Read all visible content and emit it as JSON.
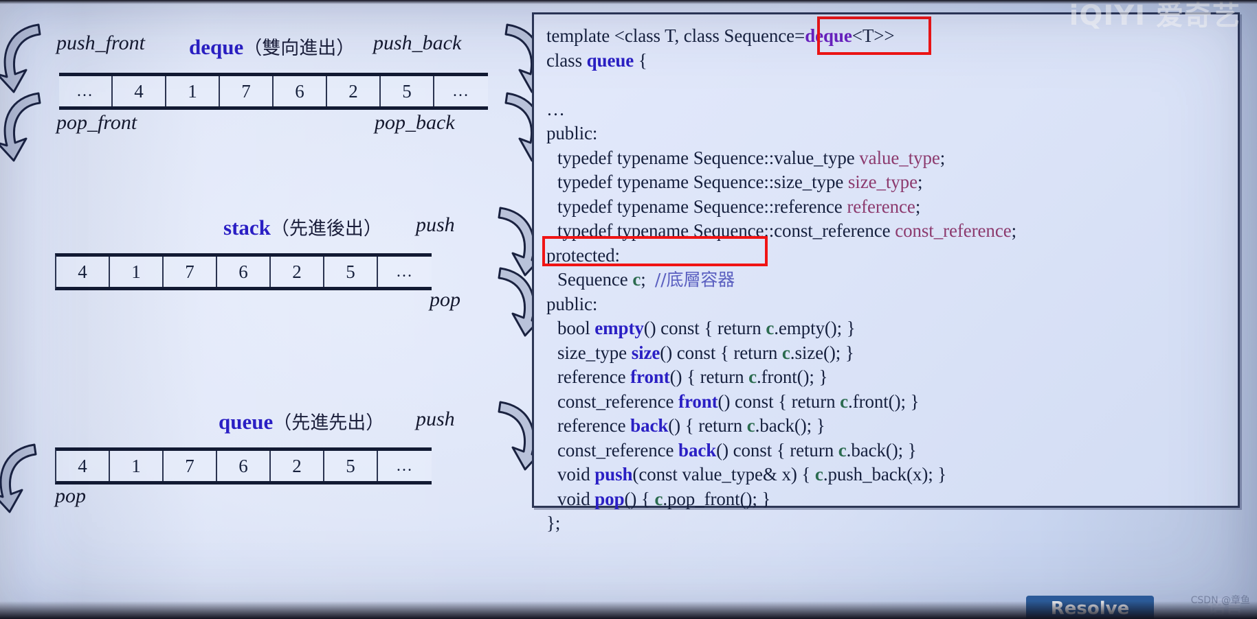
{
  "watermarks": {
    "top_right": "iQIYI 爱奇艺",
    "bottom_right": "CSDN @章鱼",
    "bottom_tab": "Resolve",
    "bottom_cjk": "语言"
  },
  "colors": {
    "keyword_blue": "#2a1fc4",
    "deque_purple": "#6a20c0",
    "typedef_pink": "#8c3a6e",
    "member_green": "#2b6b4f",
    "comment_blue": "#5a5fc0",
    "highlight_red": "#f01414",
    "slide_bg": "#dfe6f8",
    "ink": "#16203e"
  },
  "diagrams": [
    {
      "id": "deque",
      "keyword": "deque",
      "cjk_note": "（雙向進出）",
      "cells": [
        "…",
        "4",
        "1",
        "7",
        "6",
        "2",
        "5",
        "…"
      ],
      "ops": {
        "top_left": "push_front",
        "top_right": "push_back",
        "bottom_left": "pop_front",
        "bottom_right": "pop_back"
      }
    },
    {
      "id": "stack",
      "keyword": "stack",
      "cjk_note": "（先進後出）",
      "cells": [
        "4",
        "1",
        "7",
        "6",
        "2",
        "5",
        "…"
      ],
      "ops": {
        "top_right": "push",
        "bottom_right": "pop"
      }
    },
    {
      "id": "queue",
      "keyword": "queue",
      "cjk_note": "（先進先出）",
      "cells": [
        "4",
        "1",
        "7",
        "6",
        "2",
        "5",
        "…"
      ],
      "ops": {
        "top_right": "push",
        "bottom_left": "pop"
      }
    }
  ],
  "code": {
    "lines": [
      {
        "indent": 0,
        "parts": [
          {
            "t": "template <class T, class Sequence=",
            "c": "plain"
          },
          {
            "t": "deque",
            "c": "dq"
          },
          {
            "t": "<T>>",
            "c": "plain"
          }
        ]
      },
      {
        "indent": 0,
        "parts": [
          {
            "t": "class ",
            "c": "plain"
          },
          {
            "t": "queue",
            "c": "fn"
          },
          {
            "t": " {",
            "c": "plain"
          }
        ]
      },
      {
        "indent": 0,
        "parts": [
          {
            "t": "",
            "c": "plain"
          }
        ]
      },
      {
        "indent": 0,
        "parts": [
          {
            "t": "…",
            "c": "dots"
          }
        ]
      },
      {
        "indent": 0,
        "parts": [
          {
            "t": "public:",
            "c": "plain"
          }
        ]
      },
      {
        "indent": 1,
        "parts": [
          {
            "t": "typedef typename Sequence::value_type ",
            "c": "plain"
          },
          {
            "t": "value_type",
            "c": "vn"
          },
          {
            "t": ";",
            "c": "plain"
          }
        ]
      },
      {
        "indent": 1,
        "parts": [
          {
            "t": "typedef typename Sequence::size_type ",
            "c": "plain"
          },
          {
            "t": "size_type",
            "c": "vn"
          },
          {
            "t": ";",
            "c": "plain"
          }
        ]
      },
      {
        "indent": 1,
        "parts": [
          {
            "t": "typedef typename Sequence::reference ",
            "c": "plain"
          },
          {
            "t": "reference",
            "c": "vn"
          },
          {
            "t": ";",
            "c": "plain"
          }
        ]
      },
      {
        "indent": 1,
        "parts": [
          {
            "t": "typedef typename Sequence::const_reference ",
            "c": "plain"
          },
          {
            "t": "const_reference",
            "c": "vn"
          },
          {
            "t": ";",
            "c": "plain"
          }
        ]
      },
      {
        "indent": 0,
        "parts": [
          {
            "t": "protected:",
            "c": "plain"
          }
        ]
      },
      {
        "indent": 1,
        "parts": [
          {
            "t": "Sequence ",
            "c": "plain"
          },
          {
            "t": "c",
            "c": "ct"
          },
          {
            "t": ";  ",
            "c": "plain"
          },
          {
            "t": "//底層容器",
            "c": "cmt"
          }
        ]
      },
      {
        "indent": 0,
        "parts": [
          {
            "t": "public:",
            "c": "plain"
          }
        ]
      },
      {
        "indent": 1,
        "parts": [
          {
            "t": "bool ",
            "c": "plain"
          },
          {
            "t": "empty",
            "c": "fn"
          },
          {
            "t": "() const { return ",
            "c": "plain"
          },
          {
            "t": "c",
            "c": "ct"
          },
          {
            "t": ".empty(); }",
            "c": "plain"
          }
        ]
      },
      {
        "indent": 1,
        "parts": [
          {
            "t": "size_type ",
            "c": "plain"
          },
          {
            "t": "size",
            "c": "fn"
          },
          {
            "t": "() const { return ",
            "c": "plain"
          },
          {
            "t": "c",
            "c": "ct"
          },
          {
            "t": ".size(); }",
            "c": "plain"
          }
        ]
      },
      {
        "indent": 1,
        "parts": [
          {
            "t": "reference ",
            "c": "plain"
          },
          {
            "t": "front",
            "c": "fn"
          },
          {
            "t": "() { return ",
            "c": "plain"
          },
          {
            "t": "c",
            "c": "ct"
          },
          {
            "t": ".front(); }",
            "c": "plain"
          }
        ]
      },
      {
        "indent": 1,
        "parts": [
          {
            "t": "const_reference ",
            "c": "plain"
          },
          {
            "t": "front",
            "c": "fn"
          },
          {
            "t": "() const { return ",
            "c": "plain"
          },
          {
            "t": "c",
            "c": "ct"
          },
          {
            "t": ".front(); }",
            "c": "plain"
          }
        ]
      },
      {
        "indent": 1,
        "parts": [
          {
            "t": "reference ",
            "c": "plain"
          },
          {
            "t": "back",
            "c": "fn"
          },
          {
            "t": "() { return ",
            "c": "plain"
          },
          {
            "t": "c",
            "c": "ct"
          },
          {
            "t": ".back(); }",
            "c": "plain"
          }
        ]
      },
      {
        "indent": 1,
        "parts": [
          {
            "t": "const_reference ",
            "c": "plain"
          },
          {
            "t": "back",
            "c": "fn"
          },
          {
            "t": "() const { return ",
            "c": "plain"
          },
          {
            "t": "c",
            "c": "ct"
          },
          {
            "t": ".back(); }",
            "c": "plain"
          }
        ]
      },
      {
        "indent": 1,
        "parts": [
          {
            "t": "void ",
            "c": "plain"
          },
          {
            "t": "push",
            "c": "fn"
          },
          {
            "t": "(const value_type& x) { ",
            "c": "plain"
          },
          {
            "t": "c",
            "c": "ct"
          },
          {
            "t": ".push_back(x); }",
            "c": "plain"
          }
        ]
      },
      {
        "indent": 1,
        "parts": [
          {
            "t": "void ",
            "c": "plain"
          },
          {
            "t": "pop",
            "c": "fn"
          },
          {
            "t": "() { ",
            "c": "plain"
          },
          {
            "t": "c",
            "c": "ct"
          },
          {
            "t": ".pop_front(); }",
            "c": "plain"
          }
        ]
      },
      {
        "indent": 0,
        "parts": [
          {
            "t": "};",
            "c": "plain"
          }
        ]
      }
    ],
    "highlights": [
      {
        "name": "deque-default-sequence",
        "target": "deque<T>"
      },
      {
        "name": "underlying-container",
        "target": "Sequence c; //底層容器"
      }
    ]
  }
}
